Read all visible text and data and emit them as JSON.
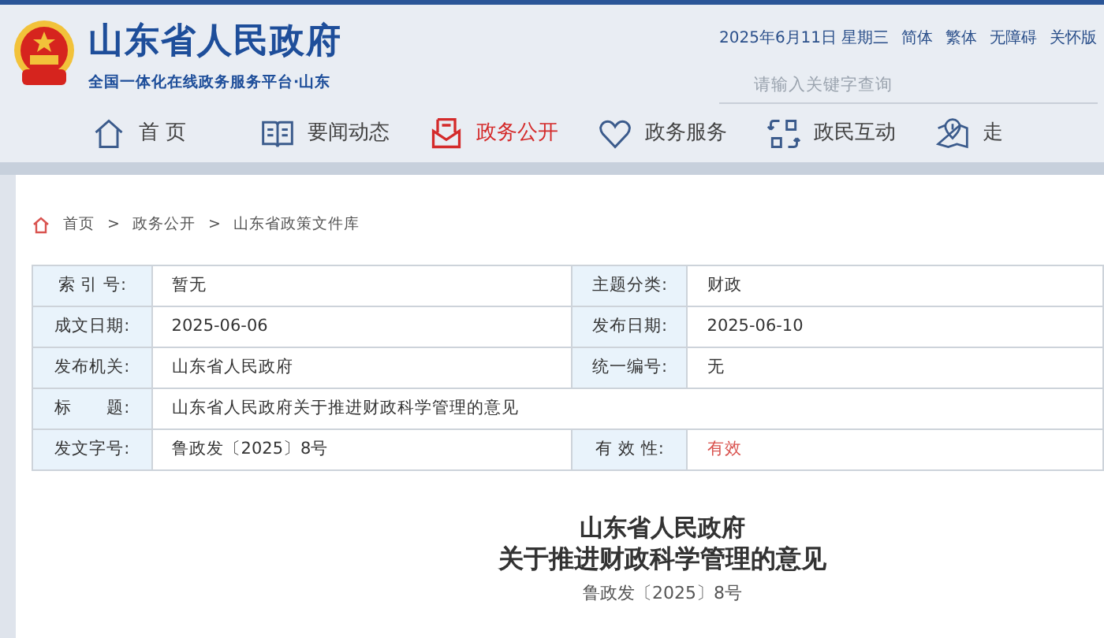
{
  "header": {
    "site_title": "山东省人民政府",
    "subtitle": "全国一体化在线政务服务平台·山东",
    "date": "2025年6月11日 星期三",
    "links": [
      "简体",
      "繁体",
      "无障碍",
      "关怀版"
    ],
    "search": {
      "placeholder": "请输入关键字查询"
    }
  },
  "nav": [
    {
      "label": "首 页",
      "kind": "house",
      "selected": false
    },
    {
      "label": "要闻动态",
      "kind": "book",
      "selected": false
    },
    {
      "label": "政务公开",
      "kind": "mail",
      "selected": true
    },
    {
      "label": "政务服务",
      "kind": "heart",
      "selected": false
    },
    {
      "label": "政民互动",
      "kind": "swap",
      "selected": false
    },
    {
      "label": "走",
      "kind": "map",
      "selected": false
    }
  ],
  "breadcrumb": {
    "separator": ">",
    "items": [
      "首页",
      "政务公开",
      "山东省政策文件库"
    ]
  },
  "meta_table": {
    "rows": [
      [
        {
          "label": "索 引 号:",
          "value": "暂无",
          "highlight": false
        },
        {
          "label": "主题分类:",
          "value": "财政",
          "highlight": false
        }
      ],
      [
        {
          "label": "成文日期:",
          "value": "2025-06-06",
          "highlight": false
        },
        {
          "label": "发布日期:",
          "value": "2025-06-10",
          "highlight": false
        }
      ],
      [
        {
          "label": "发布机关:",
          "value": "山东省人民政府",
          "highlight": false
        },
        {
          "label": "统一编号:",
          "value": "无",
          "highlight": false
        }
      ],
      [
        {
          "label": "标　　题:",
          "value": "山东省人民政府关于推进财政科学管理的意见",
          "highlight": false
        }
      ],
      [
        {
          "label": "发文字号:",
          "value": "鲁政发〔2025〕8号",
          "highlight": false
        },
        {
          "label": "有 效 性:",
          "value": "有效",
          "highlight": true
        }
      ]
    ]
  },
  "document": {
    "issuer": "山东省人民政府",
    "title": "关于推进财政科学管理的意见",
    "number": "鲁政发〔2025〕8号"
  }
}
